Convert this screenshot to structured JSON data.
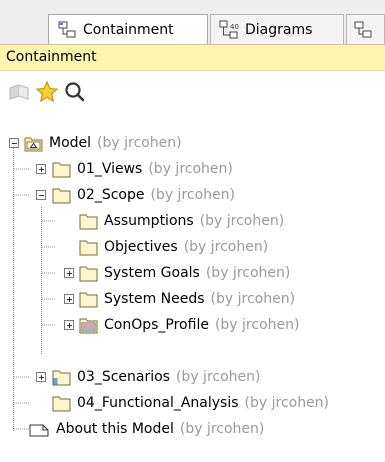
{
  "tabs": [
    {
      "label": "Containment",
      "icon": "containment-tree-icon",
      "active": true
    },
    {
      "label": "Diagrams",
      "icon": "diagrams-icon",
      "active": false
    },
    {
      "label": "",
      "icon": "structure-icon",
      "active": false
    }
  ],
  "panel": {
    "title": "Containment"
  },
  "toolbar": [
    {
      "name": "collapse-all-icon"
    },
    {
      "name": "favorites-star-icon"
    },
    {
      "name": "search-icon"
    }
  ],
  "tree": {
    "owner_text": "(by jrcohen)",
    "nodes": [
      {
        "label": "Model",
        "owner": "(by jrcohen)",
        "icon": "model-package-icon"
      },
      {
        "label": "01_Views",
        "owner": "(by jrcohen)",
        "icon": "folder-icon"
      },
      {
        "label": "02_Scope",
        "owner": "(by jrcohen)",
        "icon": "folder-icon"
      },
      {
        "label": "Assumptions",
        "owner": "(by jrcohen)",
        "icon": "folder-icon"
      },
      {
        "label": "Objectives",
        "owner": "(by jrcohen)",
        "icon": "folder-icon"
      },
      {
        "label": "System Goals",
        "owner": "(by jrcohen)",
        "icon": "folder-icon"
      },
      {
        "label": "System Needs",
        "owner": "(by jrcohen)",
        "icon": "folder-icon"
      },
      {
        "label": "ConOps_Profile",
        "owner": "(by jrcohen)",
        "icon": "profile-package-icon"
      },
      {
        "label": "03_Scenarios",
        "owner": "(by jrcohen)",
        "icon": "scenario-folder-icon"
      },
      {
        "label": "04_Functional_Analysis",
        "owner": "(by jrcohen)",
        "icon": "folder-icon"
      },
      {
        "label": "About this Model",
        "owner": "(by jrcohen)",
        "icon": "note-icon"
      }
    ]
  }
}
